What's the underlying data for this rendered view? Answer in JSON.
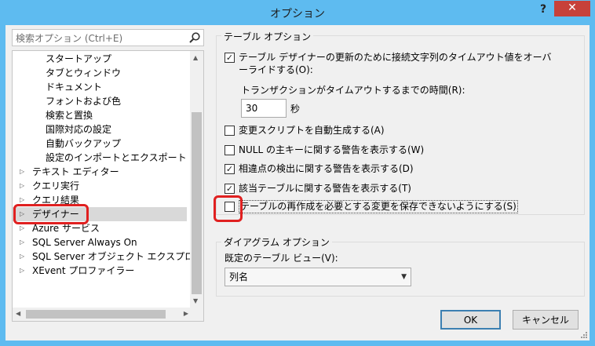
{
  "window": {
    "title": "オプション",
    "help": "?",
    "close": "✕"
  },
  "search": {
    "placeholder": "検索オプション (Ctrl+E)"
  },
  "tree": {
    "children": [
      {
        "label": "スタートアップ"
      },
      {
        "label": "タブとウィンドウ"
      },
      {
        "label": "ドキュメント"
      },
      {
        "label": "フォントおよび色"
      },
      {
        "label": "検索と置換"
      },
      {
        "label": "国際対応の設定"
      },
      {
        "label": "自動バックアップ"
      },
      {
        "label": "設定のインポートとエクスポート"
      }
    ],
    "nodes": [
      {
        "label": "テキスト エディター"
      },
      {
        "label": "クエリ実行"
      },
      {
        "label": "クエリ結果"
      },
      {
        "label": "デザイナー"
      },
      {
        "label": "Azure サービス"
      },
      {
        "label": "SQL Server Always On"
      },
      {
        "label": "SQL Server オブジェクト エクスプローラー"
      },
      {
        "label": "XEvent プロファイラー"
      }
    ]
  },
  "table_options": {
    "title": "テーブル オプション",
    "timeout_override": {
      "label_line1": "テーブル デザイナーの更新のために接続文字列のタイムアウト値をオーバ",
      "label_line2": "ーライドする(O):",
      "checked": true
    },
    "transaction_timeout_label": "トランザクションがタイムアウトするまでの時間(R):",
    "transaction_timeout_value": "30",
    "seconds_unit": "秒",
    "auto_script": {
      "label": "変更スクリプトを自動生成する(A)",
      "checked": false
    },
    "null_pk_warning": {
      "label": "NULL の主キーに関する警告を表示する(W)",
      "checked": false
    },
    "incompatibility_warning": {
      "label": "相違点の検出に関する警告を表示する(D)",
      "checked": true
    },
    "affected_tables_warning": {
      "label": "該当テーブルに関する警告を表示する(T)",
      "checked": true
    },
    "prevent_saving": {
      "label": "テーブルの再作成を必要とする変更を保存できないようにする(S)",
      "checked": false
    }
  },
  "diagram_options": {
    "title": "ダイアグラム オプション",
    "default_view_label": "既定のテーブル ビュー(V):",
    "default_view_value": "列名"
  },
  "buttons": {
    "ok": "OK",
    "cancel": "キャンセル"
  },
  "colors": {
    "title_bar": "#5ebbf0",
    "close_button": "#c7413a",
    "highlight_marker": "#e02020"
  }
}
